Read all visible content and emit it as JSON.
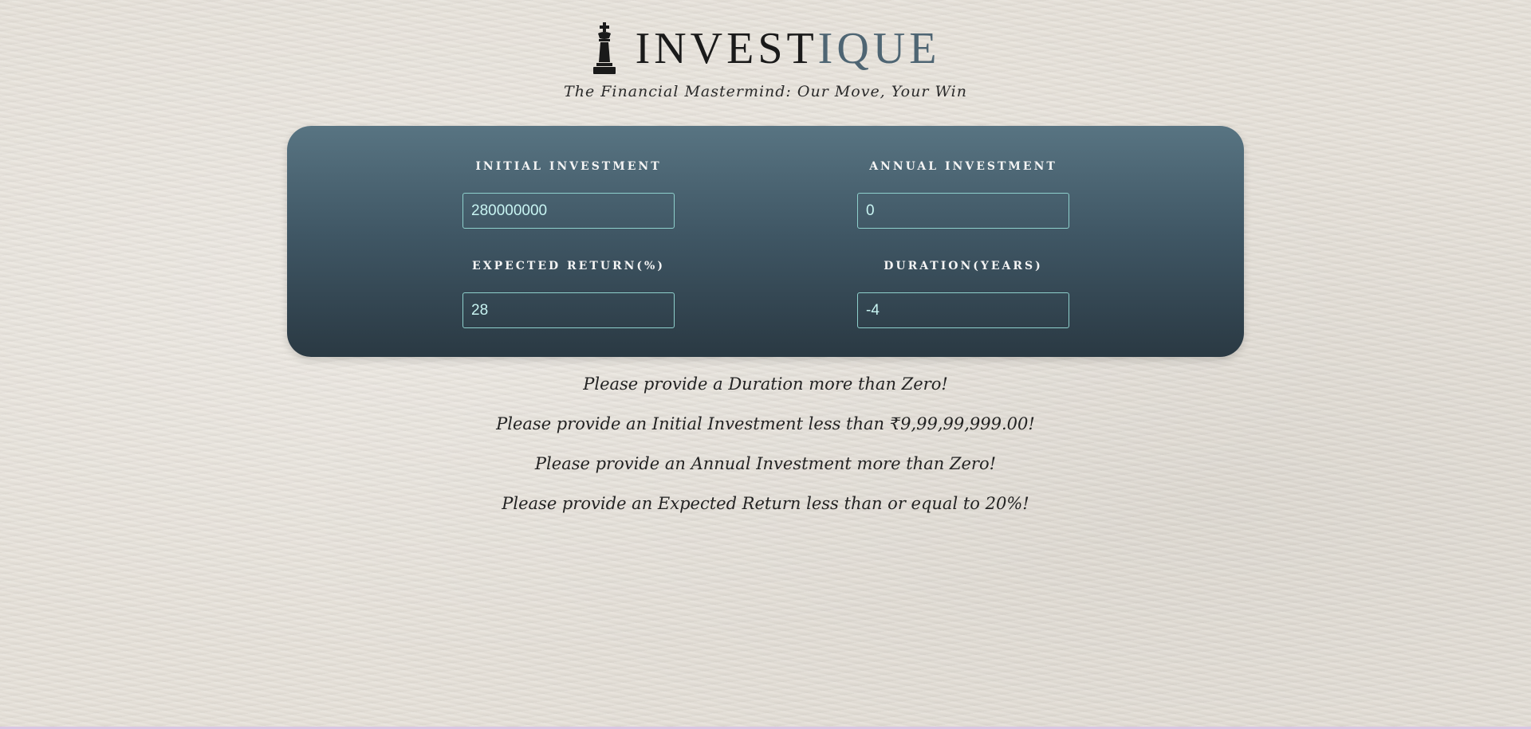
{
  "header": {
    "brand_main": "INVEST",
    "brand_accent": "IQUE",
    "tagline": "The Financial Mastermind: Our Move, Your Win",
    "logo_icon": "chess-king-icon"
  },
  "form": {
    "initial_investment": {
      "label": "INITIAL INVESTMENT",
      "value": "280000000"
    },
    "annual_investment": {
      "label": "ANNUAL INVESTMENT",
      "value": "0"
    },
    "expected_return": {
      "label": "EXPECTED RETURN(%)",
      "value": "28"
    },
    "duration": {
      "label": "DURATION(YEARS)",
      "value": "-4"
    }
  },
  "messages": [
    "Please provide a Duration more than Zero!",
    "Please provide an Initial Investment less than ₹9,99,99,999.00!",
    "Please provide an Annual Investment more than Zero!",
    "Please provide an Expected Return less than or equal to 20%!"
  ],
  "colors": {
    "brand_accent": "#4e6573",
    "panel_top": "#587482",
    "panel_bottom": "#2a3943",
    "input_border": "#8ed0cc",
    "input_text": "#c8f4f2",
    "background": "#e6e1d9"
  }
}
